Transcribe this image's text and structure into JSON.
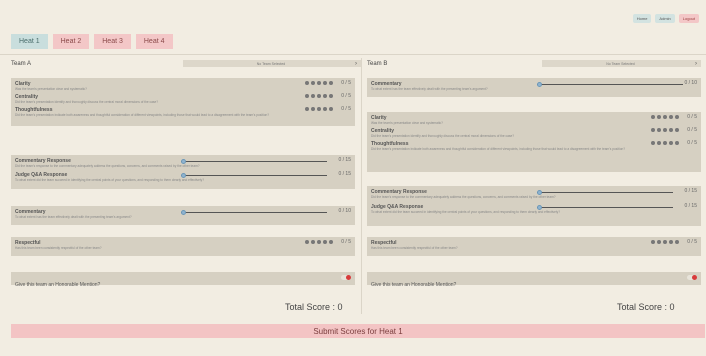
{
  "nav": {
    "home": "Home",
    "admin": "Admin",
    "logout": "Logout"
  },
  "heats": [
    "Heat 1",
    "Heat 2",
    "Heat 3",
    "Heat 4"
  ],
  "active_heat_index": 0,
  "team_a": {
    "name": "Team A",
    "select": "No Team Selected",
    "criteria": [
      {
        "label": "Clarity",
        "desc": "Was the team's presentation clear and systematic?",
        "score": "0 / 5"
      },
      {
        "label": "Centrality",
        "desc": "Did the team's presentation identify and thoroughly discuss the central moral dimensions of the case?",
        "score": "0 / 5"
      },
      {
        "label": "Thoughtfulness",
        "desc": "Did the team's presentation indicate both awareness and thoughtful consideration of different viewpoints, including those that would lead to a disagreement with the team's position?",
        "score": "0 / 5"
      }
    ],
    "commentary_response": {
      "label": "Commentary Response",
      "desc": "Did the team's response to the commentary adequately address the questions, concerns, and comments raised by the other team?",
      "score": "0 / 15",
      "value": 0
    },
    "judge_qa": {
      "label": "Judge Q&A Response",
      "desc": "To what extent did the team succeed in identifying the central points of your questions, and responding to them clearly and effectively?",
      "score": "0 / 15",
      "value": 0
    },
    "commentary": {
      "label": "Commentary",
      "desc": "To what extent has the team effectively dealt with the presenting team's argument?",
      "score": "0 / 10",
      "value": 0
    },
    "respectful": {
      "label": "Respectful",
      "desc": "Has this team been consistently respectful of the other team?",
      "score": "0 / 5"
    },
    "mention": "Give this team an Honorable Mention?",
    "total": "Total Score : 0"
  },
  "team_b": {
    "name": "Team B",
    "select": "No Team Selected",
    "commentary": {
      "label": "Commentary",
      "desc": "To what extent has the team effectively dealt with the presenting team's argument?",
      "score": "0 / 10",
      "value": 0
    },
    "criteria": [
      {
        "label": "Clarity",
        "desc": "Was the team's presentation clear and systematic?",
        "score": "0 / 5"
      },
      {
        "label": "Centrality",
        "desc": "Did the team's presentation identify and thoroughly discuss the central moral dimensions of the case?",
        "score": "0 / 5"
      },
      {
        "label": "Thoughtfulness",
        "desc": "Did the team's presentation indicate both awareness and thoughtful consideration of different viewpoints, including those that would lead to a disagreement with the team's position?",
        "score": "0 / 5"
      }
    ],
    "commentary_response": {
      "label": "Commentary Response",
      "desc": "Did the team's response to the commentary adequately address the questions, concerns, and comments raised by the other team?",
      "score": "0 / 15",
      "value": 0
    },
    "judge_qa": {
      "label": "Judge Q&A Response",
      "desc": "To what extent did the team succeed in identifying the central points of your questions, and responding to them clearly and effectively?",
      "score": "0 / 15",
      "value": 0
    },
    "respectful": {
      "label": "Respectful",
      "desc": "Has this team been consistently respectful of the other team?",
      "score": "0 / 5"
    },
    "mention": "Give this team an Honorable Mention?",
    "total": "Total Score : 0"
  },
  "submit_label": "Submit Scores for Heat 1",
  "colors": {
    "tab_active": "#c9dedd",
    "tab_inactive": "#f3c7c7",
    "card": "#d6d0c2",
    "submit": "#f3c4c4",
    "toggle_off": "#d83b3b"
  }
}
